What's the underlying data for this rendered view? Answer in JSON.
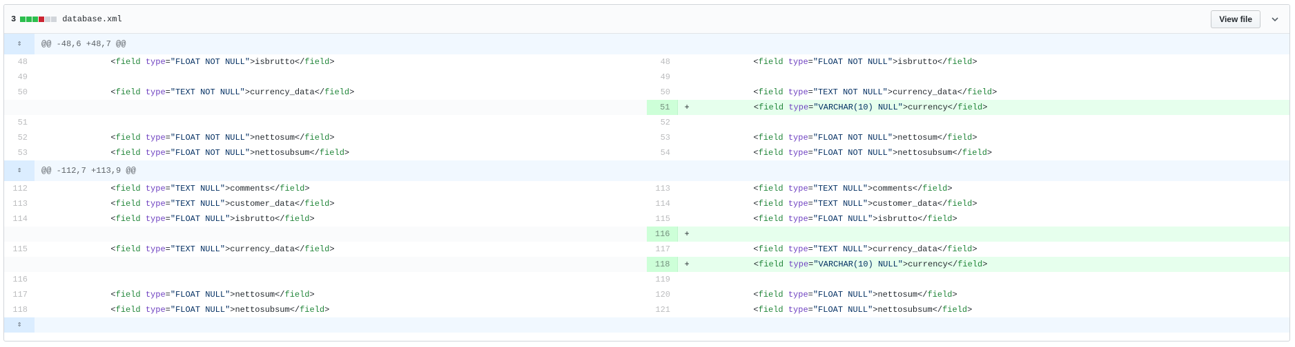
{
  "file": {
    "change_count": "3",
    "diffstat": [
      "#2cbe4e",
      "#2cbe4e",
      "#2cbe4e",
      "#cb2431",
      "#d1d5da",
      "#d1d5da"
    ],
    "name": "database.xml",
    "view_button": "View file"
  },
  "expand_glyph": "⇕",
  "hunks": [
    {
      "header": "@@ -48,6 +48,7 @@",
      "rows": [
        {
          "type": "ctx",
          "l": "48",
          "r": "48",
          "tag": "field",
          "val": "FLOAT NOT NULL",
          "text": "isbrutto"
        },
        {
          "type": "blank",
          "l": "49",
          "r": "49"
        },
        {
          "type": "ctx",
          "l": "50",
          "r": "50",
          "tag": "field",
          "val": "TEXT NOT NULL",
          "text": "currency_data"
        },
        {
          "type": "add",
          "r": "51",
          "tag": "field",
          "val": "VARCHAR(10) NULL",
          "text": "currency"
        },
        {
          "type": "blank",
          "l": "51",
          "r": "52"
        },
        {
          "type": "ctx",
          "l": "52",
          "r": "53",
          "tag": "field",
          "val": "FLOAT NOT NULL",
          "text": "nettosum"
        },
        {
          "type": "ctx",
          "l": "53",
          "r": "54",
          "tag": "field",
          "val": "FLOAT NOT NULL",
          "text": "nettosubsum"
        }
      ]
    },
    {
      "header": "@@ -112,7 +113,9 @@",
      "rows": [
        {
          "type": "ctx",
          "l": "112",
          "r": "113",
          "tag": "field",
          "val": "TEXT NULL",
          "text": "comments"
        },
        {
          "type": "ctx",
          "l": "113",
          "r": "114",
          "tag": "field",
          "val": "TEXT NULL",
          "text": "customer_data"
        },
        {
          "type": "ctx",
          "l": "114",
          "r": "115",
          "tag": "field",
          "val": "FLOAT NULL",
          "text": "isbrutto"
        },
        {
          "type": "addblank",
          "r": "116"
        },
        {
          "type": "ctx",
          "l": "115",
          "r": "117",
          "tag": "field",
          "val": "TEXT NULL",
          "text": "currency_data"
        },
        {
          "type": "add",
          "r": "118",
          "tag": "field",
          "val": "VARCHAR(10) NULL",
          "text": "currency"
        },
        {
          "type": "blank",
          "l": "116",
          "r": "119"
        },
        {
          "type": "ctx",
          "l": "117",
          "r": "120",
          "tag": "field",
          "val": "FLOAT NULL",
          "text": "nettosum"
        },
        {
          "type": "ctx",
          "l": "118",
          "r": "121",
          "tag": "field",
          "val": "FLOAT NULL",
          "text": "nettosubsum"
        }
      ]
    }
  ],
  "syntax": {
    "attr_name": "type",
    "indent": "            ",
    "plus": "+"
  }
}
